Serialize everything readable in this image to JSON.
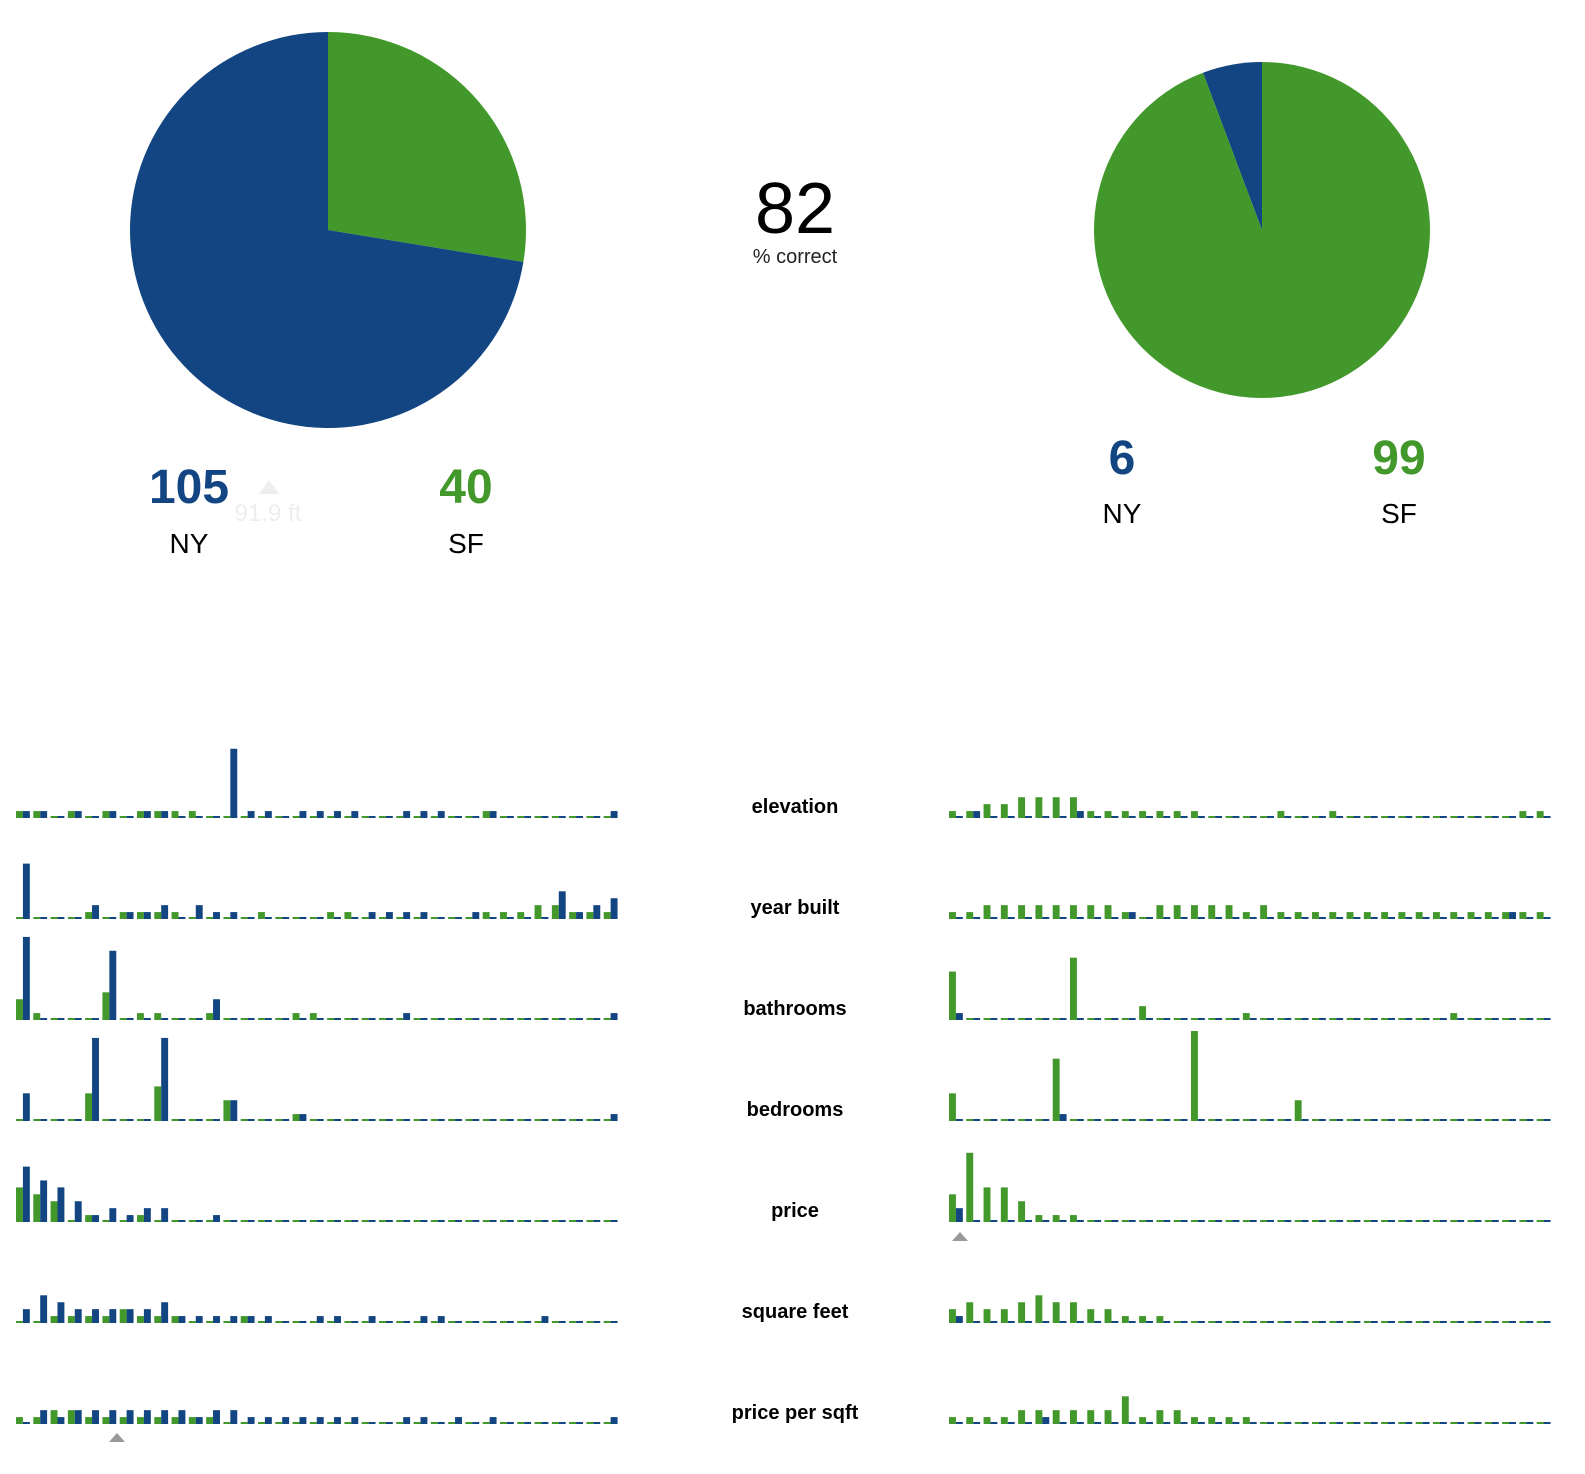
{
  "colors": {
    "ny": "#124581",
    "sf": "#43982c",
    "marker": "#999999"
  },
  "accuracy": {
    "value": "82",
    "label": "% correct"
  },
  "hover_tooltip": {
    "text": "91.9 ft"
  },
  "chart_data": [
    {
      "type": "pie",
      "slices": [
        {
          "label": "NY",
          "value": 105,
          "color": "#124581"
        },
        {
          "label": "SF",
          "value": 40,
          "color": "#43982c"
        }
      ],
      "counts": [
        {
          "value": "105",
          "label": "NY"
        },
        {
          "value": "40",
          "label": "SF"
        }
      ]
    },
    {
      "type": "pie",
      "slices": [
        {
          "label": "NY",
          "value": 6,
          "color": "#124581"
        },
        {
          "label": "SF",
          "value": 99,
          "color": "#43982c"
        }
      ],
      "counts": [
        {
          "value": "6",
          "label": "NY"
        },
        {
          "value": "99",
          "label": "SF"
        }
      ]
    },
    {
      "type": "bar",
      "features": [
        {
          "name": "elevation",
          "left": {
            "sf": [
              1,
              1,
              0,
              1,
              0,
              1,
              0,
              1,
              1,
              1,
              1,
              0,
              0,
              0,
              0,
              0,
              0,
              0,
              0,
              0,
              0,
              0,
              0,
              0,
              0,
              0,
              0,
              1,
              0,
              0,
              0,
              0,
              0,
              0,
              0
            ],
            "ny": [
              1,
              1,
              0,
              1,
              0,
              1,
              0,
              1,
              1,
              0,
              0,
              0,
              10,
              1,
              1,
              0,
              1,
              1,
              1,
              1,
              0,
              0,
              1,
              1,
              1,
              0,
              0,
              1,
              0,
              0,
              0,
              0,
              0,
              0,
              1
            ]
          },
          "right": {
            "sf": [
              1,
              1,
              2,
              2,
              3,
              3,
              3,
              3,
              1,
              1,
              1,
              1,
              1,
              1,
              1,
              0,
              0,
              0,
              0,
              1,
              0,
              0,
              1,
              0,
              0,
              0,
              0,
              0,
              0,
              0,
              0,
              0,
              0,
              1,
              1
            ],
            "ny": [
              0,
              1,
              0,
              0,
              0,
              0,
              0,
              1,
              0,
              0,
              0,
              0,
              0,
              0,
              0,
              0,
              0,
              0,
              0,
              0,
              0,
              0,
              0,
              0,
              0,
              0,
              0,
              0,
              0,
              0,
              0,
              0,
              0,
              0,
              0
            ]
          }
        },
        {
          "name": "year built",
          "left": {
            "sf": [
              0,
              0,
              0,
              0,
              1,
              0,
              1,
              1,
              1,
              1,
              0,
              0,
              0,
              0,
              1,
              0,
              0,
              0,
              1,
              1,
              0,
              0,
              0,
              0,
              0,
              0,
              0,
              1,
              1,
              1,
              2,
              2,
              1,
              1,
              1
            ],
            "ny": [
              8,
              0,
              0,
              0,
              2,
              0,
              1,
              1,
              2,
              0,
              2,
              1,
              1,
              0,
              0,
              0,
              0,
              0,
              0,
              0,
              1,
              1,
              1,
              1,
              0,
              0,
              1,
              0,
              0,
              0,
              0,
              4,
              1,
              2,
              3
            ]
          },
          "right": {
            "sf": [
              1,
              1,
              2,
              2,
              2,
              2,
              2,
              2,
              2,
              2,
              1,
              0,
              2,
              2,
              2,
              2,
              2,
              1,
              2,
              1,
              1,
              1,
              1,
              1,
              1,
              1,
              1,
              1,
              1,
              1,
              1,
              1,
              1,
              1,
              1
            ],
            "ny": [
              0,
              0,
              0,
              0,
              0,
              0,
              0,
              0,
              0,
              0,
              1,
              0,
              0,
              0,
              0,
              0,
              0,
              0,
              0,
              0,
              0,
              0,
              0,
              0,
              0,
              0,
              0,
              0,
              0,
              0,
              0,
              0,
              1,
              0,
              0
            ]
          }
        },
        {
          "name": "bathrooms",
          "left": {
            "sf": [
              3,
              1,
              0,
              0,
              0,
              4,
              0,
              1,
              1,
              0,
              0,
              1,
              0,
              0,
              0,
              0,
              1,
              1,
              0,
              0,
              0,
              0,
              0,
              0,
              0,
              0,
              0,
              0,
              0,
              0,
              0,
              0,
              0,
              0,
              0
            ],
            "ny": [
              12,
              0,
              0,
              0,
              0,
              10,
              0,
              0,
              0,
              0,
              0,
              3,
              0,
              0,
              0,
              0,
              0,
              0,
              0,
              0,
              0,
              0,
              1,
              0,
              0,
              0,
              0,
              0,
              0,
              0,
              0,
              0,
              0,
              0,
              1
            ]
          },
          "right": {
            "sf": [
              7,
              0,
              0,
              0,
              0,
              0,
              0,
              9,
              0,
              0,
              0,
              2,
              0,
              0,
              0,
              0,
              0,
              1,
              0,
              0,
              0,
              0,
              0,
              0,
              0,
              0,
              0,
              0,
              0,
              1,
              0,
              0,
              0,
              0,
              0
            ],
            "ny": [
              1,
              0,
              0,
              0,
              0,
              0,
              0,
              0,
              0,
              0,
              0,
              0,
              0,
              0,
              0,
              0,
              0,
              0,
              0,
              0,
              0,
              0,
              0,
              0,
              0,
              0,
              0,
              0,
              0,
              0,
              0,
              0,
              0,
              0,
              0
            ]
          }
        },
        {
          "name": "bedrooms",
          "left": {
            "sf": [
              0,
              0,
              0,
              0,
              4,
              0,
              0,
              0,
              5,
              0,
              0,
              0,
              3,
              0,
              0,
              0,
              1,
              0,
              0,
              0,
              0,
              0,
              0,
              0,
              0,
              0,
              0,
              0,
              0,
              0,
              0,
              0,
              0,
              0,
              0
            ],
            "ny": [
              4,
              0,
              0,
              0,
              12,
              0,
              0,
              0,
              12,
              0,
              0,
              0,
              3,
              0,
              0,
              0,
              1,
              0,
              0,
              0,
              0,
              0,
              0,
              0,
              0,
              0,
              0,
              0,
              0,
              0,
              0,
              0,
              0,
              0,
              1
            ]
          },
          "right": {
            "sf": [
              4,
              0,
              0,
              0,
              0,
              0,
              9,
              0,
              0,
              0,
              0,
              0,
              0,
              0,
              13,
              0,
              0,
              0,
              0,
              0,
              3,
              0,
              0,
              0,
              0,
              0,
              0,
              0,
              0,
              0,
              0,
              0,
              0,
              0,
              0
            ],
            "ny": [
              0,
              0,
              0,
              0,
              0,
              0,
              1,
              0,
              0,
              0,
              0,
              0,
              0,
              0,
              0,
              0,
              0,
              0,
              0,
              0,
              0,
              0,
              0,
              0,
              0,
              0,
              0,
              0,
              0,
              0,
              0,
              0,
              0,
              0,
              0
            ]
          }
        },
        {
          "name": "price",
          "left": {
            "sf": [
              5,
              4,
              3,
              0,
              1,
              0,
              0,
              1,
              0,
              0,
              0,
              0,
              0,
              0,
              0,
              0,
              0,
              0,
              0,
              0,
              0,
              0,
              0,
              0,
              0,
              0,
              0,
              0,
              0,
              0,
              0,
              0,
              0,
              0,
              0
            ],
            "ny": [
              8,
              6,
              5,
              3,
              1,
              2,
              1,
              2,
              2,
              0,
              0,
              1,
              0,
              0,
              0,
              0,
              0,
              0,
              0,
              0,
              0,
              0,
              0,
              0,
              0,
              0,
              0,
              0,
              0,
              0,
              0,
              0,
              0,
              0,
              0
            ]
          },
          "right": {
            "sf": [
              4,
              10,
              5,
              5,
              3,
              1,
              1,
              1,
              0,
              0,
              0,
              0,
              0,
              0,
              0,
              0,
              0,
              0,
              0,
              0,
              0,
              0,
              0,
              0,
              0,
              0,
              0,
              0,
              0,
              0,
              0,
              0,
              0,
              0,
              0
            ],
            "ny": [
              2,
              0,
              0,
              0,
              0,
              0,
              0,
              0,
              0,
              0,
              0,
              0,
              0,
              0,
              0,
              0,
              0,
              0,
              0,
              0,
              0,
              0,
              0,
              0,
              0,
              0,
              0,
              0,
              0,
              0,
              0,
              0,
              0,
              0,
              0
            ]
          }
        },
        {
          "name": "square feet",
          "left": {
            "sf": [
              0,
              0,
              1,
              1,
              1,
              1,
              2,
              1,
              1,
              1,
              0,
              0,
              0,
              1,
              0,
              0,
              0,
              0,
              0,
              0,
              0,
              0,
              0,
              0,
              0,
              0,
              0,
              0,
              0,
              0,
              0,
              0,
              0,
              0,
              0
            ],
            "ny": [
              2,
              4,
              3,
              2,
              2,
              2,
              2,
              2,
              3,
              1,
              1,
              1,
              1,
              1,
              1,
              0,
              0,
              1,
              1,
              0,
              1,
              0,
              0,
              1,
              1,
              0,
              0,
              0,
              0,
              0,
              1,
              0,
              0,
              0,
              0
            ]
          },
          "right": {
            "sf": [
              2,
              3,
              2,
              2,
              3,
              4,
              3,
              3,
              2,
              2,
              1,
              1,
              1,
              0,
              0,
              0,
              0,
              0,
              0,
              0,
              0,
              0,
              0,
              0,
              0,
              0,
              0,
              0,
              0,
              0,
              0,
              0,
              0,
              0,
              0
            ],
            "ny": [
              1,
              0,
              0,
              0,
              0,
              0,
              0,
              0,
              0,
              0,
              0,
              0,
              0,
              0,
              0,
              0,
              0,
              0,
              0,
              0,
              0,
              0,
              0,
              0,
              0,
              0,
              0,
              0,
              0,
              0,
              0,
              0,
              0,
              0,
              0
            ]
          }
        },
        {
          "name": "price per sqft",
          "left": {
            "sf": [
              1,
              1,
              2,
              2,
              1,
              1,
              1,
              1,
              1,
              1,
              1,
              1,
              0,
              0,
              0,
              0,
              0,
              0,
              0,
              0,
              0,
              0,
              0,
              0,
              0,
              0,
              0,
              0,
              0,
              0,
              0,
              0,
              0,
              0,
              0
            ],
            "ny": [
              0,
              2,
              1,
              2,
              2,
              2,
              2,
              2,
              2,
              2,
              1,
              2,
              2,
              1,
              1,
              1,
              1,
              1,
              1,
              1,
              0,
              0,
              1,
              1,
              0,
              1,
              0,
              1,
              0,
              0,
              0,
              0,
              0,
              0,
              1
            ]
          },
          "right": {
            "sf": [
              1,
              1,
              1,
              1,
              2,
              2,
              2,
              2,
              2,
              2,
              4,
              1,
              2,
              2,
              1,
              1,
              1,
              1,
              0,
              0,
              0,
              0,
              0,
              0,
              0,
              0,
              0,
              0,
              0,
              0,
              0,
              0,
              0,
              0,
              0
            ],
            "ny": [
              0,
              0,
              0,
              0,
              0,
              1,
              0,
              0,
              0,
              0,
              0,
              0,
              0,
              0,
              0,
              0,
              0,
              0,
              0,
              0,
              0,
              0,
              0,
              0,
              0,
              0,
              0,
              0,
              0,
              0,
              0,
              0,
              0,
              0,
              0
            ]
          }
        }
      ]
    }
  ]
}
